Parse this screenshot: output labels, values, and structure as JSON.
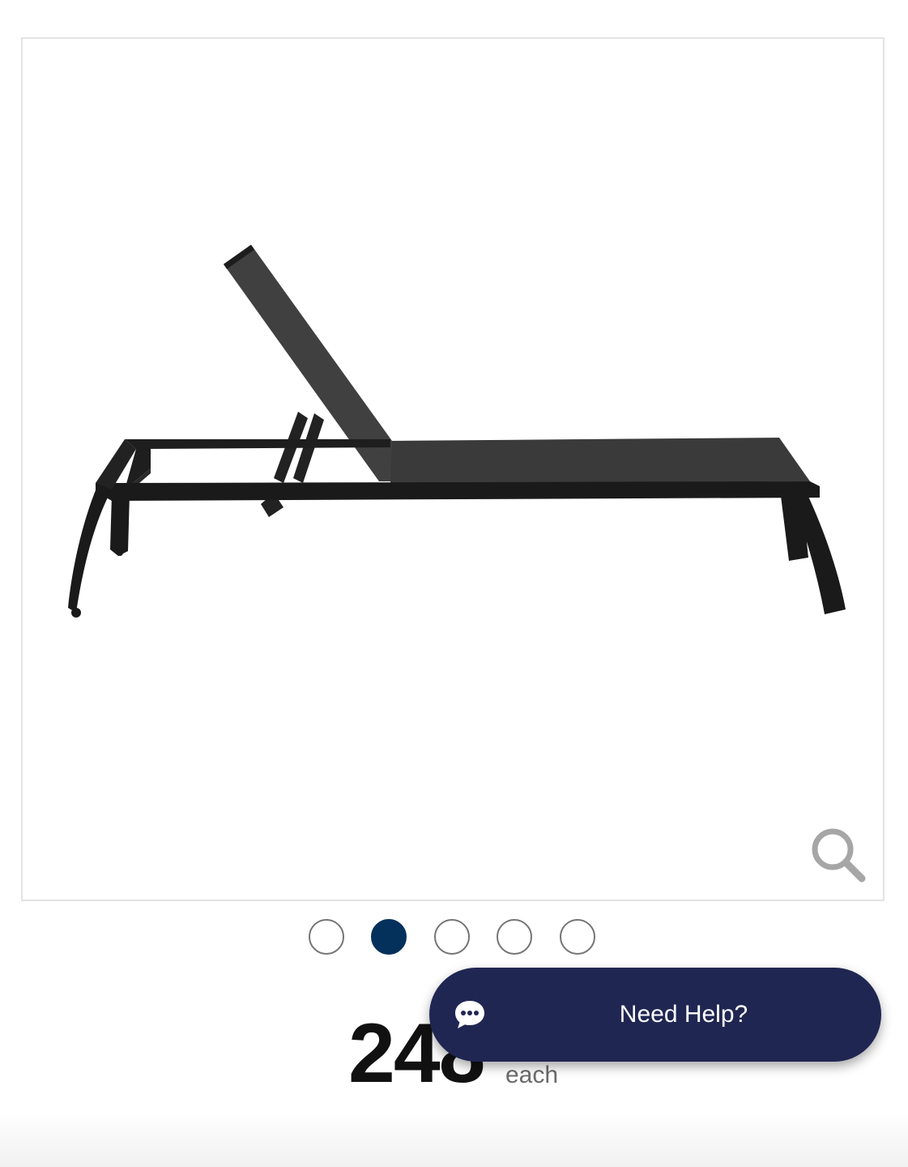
{
  "product": {
    "image_alt": "Black sling chaise lounge, side view",
    "zoom_icon": "magnifier-icon"
  },
  "carousel": {
    "total": 5,
    "active_index": 2,
    "active_color": "#04315c"
  },
  "price": {
    "amount": "248",
    "unit": "each"
  },
  "help": {
    "label": "Need Help?",
    "icon": "chat-bubble-icon",
    "background": "#202652"
  }
}
